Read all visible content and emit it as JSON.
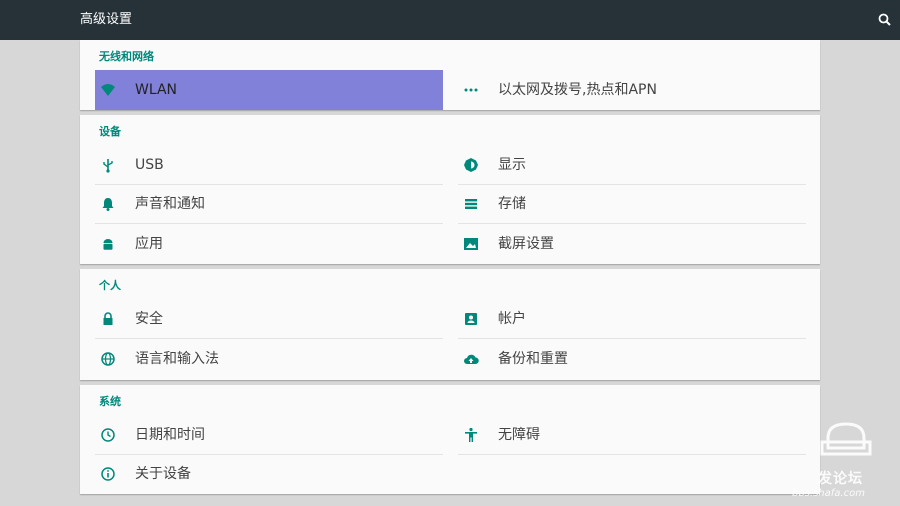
{
  "header": {
    "title": "高级设置",
    "search_icon": "search-icon"
  },
  "colors": {
    "accent": "#00897b",
    "selected_bg": "#8181d9",
    "topbar": "#263238"
  },
  "sections": {
    "network": {
      "title": "无线和网络",
      "items": [
        {
          "label": "WLAN",
          "icon": "wifi-icon",
          "selected": true
        },
        {
          "label": "以太网及拨号,热点和APN",
          "icon": "more-dots-icon"
        }
      ]
    },
    "device": {
      "title": "设备",
      "items": [
        {
          "label": "USB",
          "icon": "usb-icon"
        },
        {
          "label": "显示",
          "icon": "brightness-icon"
        },
        {
          "label": "声音和通知",
          "icon": "bell-icon"
        },
        {
          "label": "存储",
          "icon": "storage-icon"
        },
        {
          "label": "应用",
          "icon": "android-icon"
        },
        {
          "label": "截屏设置",
          "icon": "screenshot-icon"
        }
      ]
    },
    "personal": {
      "title": "个人",
      "items": [
        {
          "label": "安全",
          "icon": "lock-icon"
        },
        {
          "label": "帐户",
          "icon": "account-icon"
        },
        {
          "label": "语言和输入法",
          "icon": "globe-icon"
        },
        {
          "label": "备份和重置",
          "icon": "cloud-upload-icon"
        }
      ]
    },
    "system": {
      "title": "系统",
      "items": [
        {
          "label": "日期和时间",
          "icon": "clock-icon"
        },
        {
          "label": "无障碍",
          "icon": "accessibility-icon"
        },
        {
          "label": "关于设备",
          "icon": "info-icon"
        }
      ]
    }
  },
  "watermark": {
    "line1": "发论坛",
    "line2": "bbs.shafa.com"
  }
}
